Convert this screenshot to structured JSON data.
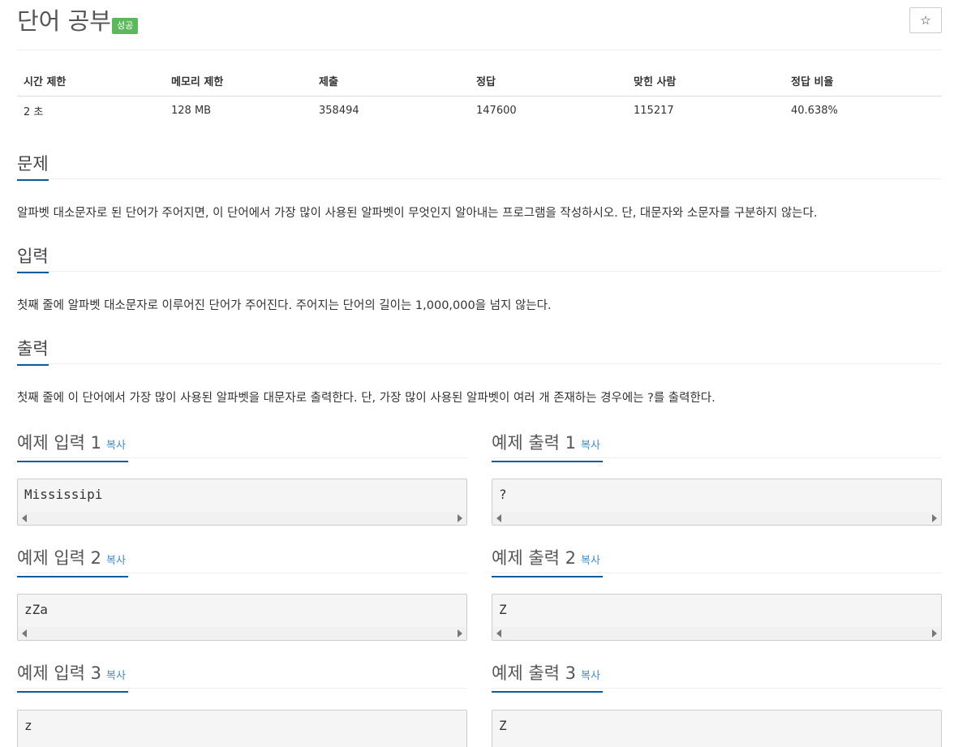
{
  "problem": {
    "title": "단어 공부",
    "badge": "성공",
    "star_icon": "☆"
  },
  "info": {
    "headers": [
      "시간 제한",
      "메모리 제한",
      "제출",
      "정답",
      "맞힌 사람",
      "정답 비율"
    ],
    "values": [
      "2 초",
      "128 MB",
      "358494",
      "147600",
      "115217",
      "40.638%"
    ]
  },
  "sections": {
    "description": {
      "title": "문제",
      "text": "알파벳 대소문자로 된 단어가 주어지면, 이 단어에서 가장 많이 사용된 알파벳이 무엇인지 알아내는 프로그램을 작성하시오. 단, 대문자와 소문자를 구분하지 않는다."
    },
    "input": {
      "title": "입력",
      "text": "첫째 줄에 알파벳 대소문자로 이루어진 단어가 주어진다. 주어지는 단어의 길이는 1,000,000을 넘지 않는다."
    },
    "output": {
      "title": "출력",
      "text": "첫째 줄에 이 단어에서 가장 많이 사용된 알파벳을 대문자로 출력한다. 단, 가장 많이 사용된 알파벳이 여러 개 존재하는 경우에는 ?를 출력한다."
    }
  },
  "copy_label": "복사",
  "examples": [
    {
      "input_title": "예제 입력 1",
      "output_title": "예제 출력 1",
      "input": "Mississipi",
      "output": "?"
    },
    {
      "input_title": "예제 입력 2",
      "output_title": "예제 출력 2",
      "input": "zZa",
      "output": "Z"
    },
    {
      "input_title": "예제 입력 3",
      "output_title": "예제 출력 3",
      "input": "z",
      "output": "Z"
    }
  ]
}
